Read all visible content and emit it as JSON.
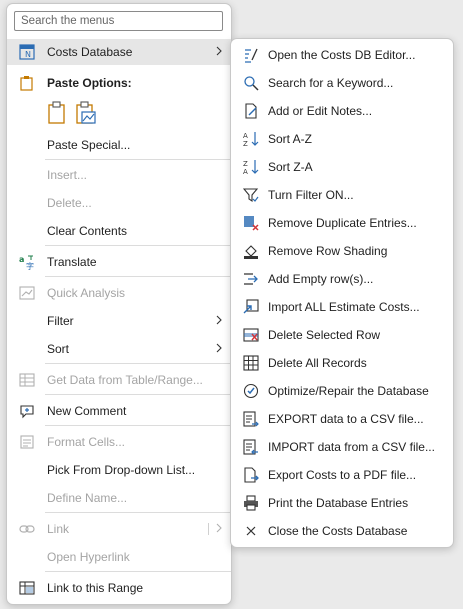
{
  "search": {
    "placeholder": "Search the menus"
  },
  "main_menu": {
    "costs_database": "Costs Database",
    "paste_options": "Paste Options:",
    "paste_special": "Paste Special...",
    "insert": "Insert...",
    "delete": "Delete...",
    "clear_contents": "Clear Contents",
    "translate": "Translate",
    "quick_analysis": "Quick Analysis",
    "filter": "Filter",
    "sort": "Sort",
    "get_data": "Get Data from Table/Range...",
    "new_comment": "New Comment",
    "format_cells": "Format Cells...",
    "pick_from_list": "Pick From Drop-down List...",
    "define_name": "Define Name...",
    "link": "Link",
    "open_hyperlink": "Open Hyperlink",
    "link_to_range": "Link to this Range"
  },
  "sub_menu": {
    "items": [
      "Open the Costs DB Editor...",
      "Search for a Keyword...",
      "Add or Edit Notes...",
      "Sort A-Z",
      "Sort Z-A",
      "Turn Filter ON...",
      "Remove Duplicate Entries...",
      "Remove Row Shading",
      "Add Empty row(s)...",
      "Import ALL Estimate Costs...",
      "Delete Selected Row",
      "Delete All Records",
      "Optimize/Repair the Database",
      "EXPORT data to a CSV file...",
      "IMPORT data from a CSV file...",
      "Export Costs to a PDF file...",
      "Print the Database Entries",
      "Close the Costs Database"
    ]
  },
  "colors": {
    "accent": "#2b6cb3",
    "red": "#d13438",
    "disabled": "#a4a4a4",
    "highlight": "#e6e6e6"
  }
}
